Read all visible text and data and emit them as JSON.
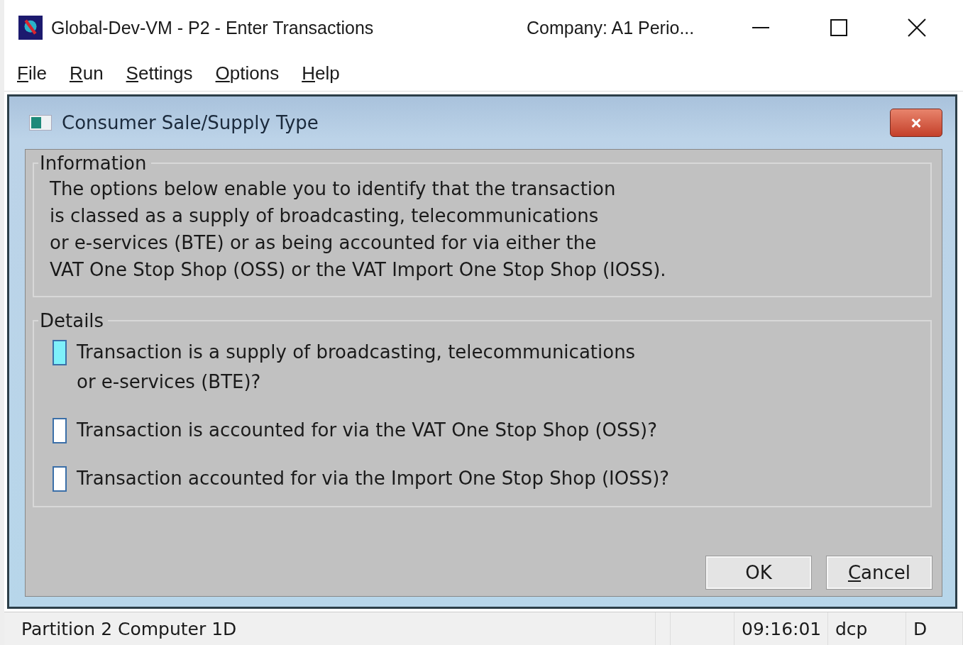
{
  "window": {
    "title": "Global-Dev-VM - P2 - Enter Transactions",
    "subtitle": "Company: A1  Perio..."
  },
  "menu": [
    {
      "access_key": "F",
      "rest": "ile"
    },
    {
      "access_key": "R",
      "rest": "un"
    },
    {
      "access_key": "S",
      "rest": "ettings"
    },
    {
      "access_key": "O",
      "rest": "ptions"
    },
    {
      "access_key": "H",
      "rest": "elp"
    }
  ],
  "dialog": {
    "title": "Consumer Sale/Supply Type",
    "information": {
      "heading": "Information",
      "lines": [
        "The options below enable you to identify that the transaction",
        "is classed as a supply of broadcasting, telecommunications",
        "or e-services (BTE) or as being accounted for via either the",
        "VAT One Stop Shop (OSS) or the VAT Import One Stop Shop (IOSS)."
      ]
    },
    "details": {
      "heading": "Details",
      "options": [
        {
          "lines": [
            "Transaction is a supply of broadcasting, telecommunications",
            "or e-services (BTE)?"
          ],
          "checked": false,
          "focused": true
        },
        {
          "lines": [
            "Transaction is accounted for via the VAT One Stop Shop (OSS)?"
          ],
          "checked": false,
          "focused": false
        },
        {
          "lines": [
            "Transaction accounted for via the Import One Stop Shop (IOSS)?"
          ],
          "checked": false,
          "focused": false
        }
      ]
    },
    "buttons": [
      {
        "rest": "OK"
      },
      {
        "access_key": "C",
        "rest": "ancel"
      }
    ]
  },
  "status_bar": {
    "left": "Partition 2 Computer 1D",
    "time": "09:16:01",
    "user": "dcp",
    "flag": "D"
  }
}
